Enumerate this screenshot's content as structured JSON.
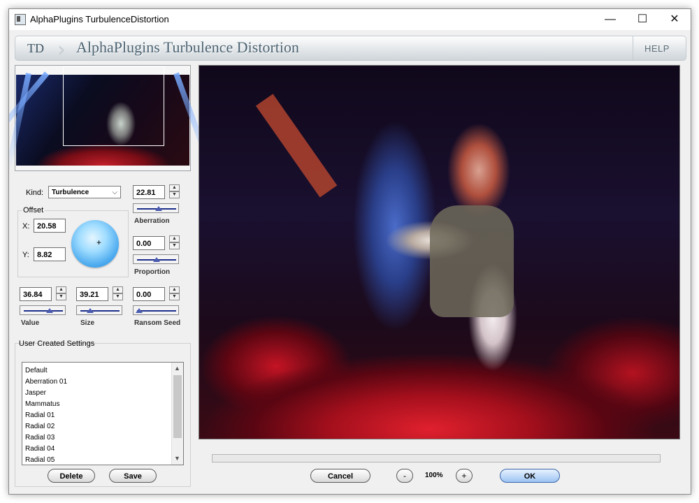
{
  "window": {
    "title": "AlphaPlugins TurbulenceDistortion",
    "controls": {
      "minimize": "—",
      "maximize": "☐",
      "close": "✕"
    }
  },
  "banner": {
    "abbr": "TD",
    "title": "AlphaPlugins Turbulence Distortion",
    "help": "HELP"
  },
  "kind": {
    "label": "Kind:",
    "value": "Turbulence"
  },
  "aberration": {
    "value": "22.81",
    "label": "Aberration",
    "slider_fraction": 0.55
  },
  "offset": {
    "label": "Offset",
    "x_label": "X:",
    "x_value": "20.58",
    "y_label": "Y:",
    "y_value": "8.82"
  },
  "proportion": {
    "value": "0.00",
    "label": "Proportion",
    "slider_fraction": 0.45
  },
  "value_ctrl": {
    "value": "36.84",
    "label": "Value",
    "slider_fraction": 0.62
  },
  "size_ctrl": {
    "value": "39.21",
    "label": "Size",
    "slider_fraction": 0.15
  },
  "seed_ctrl": {
    "value": "0.00",
    "label": "Ransom Seed",
    "slider_fraction": 0.0
  },
  "user_settings": {
    "label": "User Created Settings",
    "items": [
      "Default",
      "Aberration 01",
      "Jasper",
      "Mammatus",
      "Radial 01",
      "Radial 02",
      "Radial 03",
      "Radial 04",
      "Radial 05"
    ],
    "delete_label": "Delete",
    "save_label": "Save"
  },
  "footer": {
    "cancel_label": "Cancel",
    "zoom_out": "-",
    "zoom_level": "100%",
    "zoom_in": "+",
    "ok_label": "OK"
  }
}
